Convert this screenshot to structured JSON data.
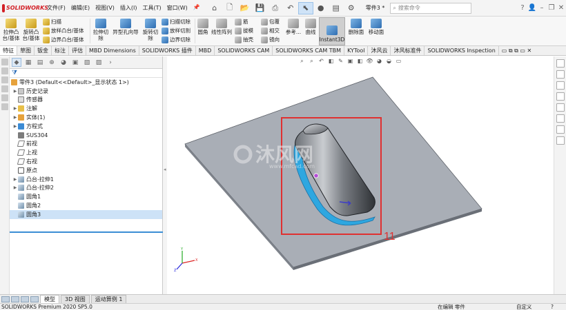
{
  "titlebar": {
    "logo_text": "SOLIDWORKS",
    "menus": [
      "文件(F)",
      "编辑(E)",
      "视图(V)",
      "插入(I)",
      "工具(T)",
      "窗口(W)"
    ],
    "doc_name": "零件3 *",
    "search_placeholder": "搜索命令"
  },
  "ribbon": {
    "extrude_boss": "拉伸凸\n台/基体",
    "revolve_boss": "旋转凸\n台/基体",
    "sweep": "扫描",
    "loft": "放样凸台/基体",
    "boundary_boss": "边界凸台/基体",
    "extrude_cut": "拉伸切\n除",
    "hole_wizard": "异型孔向导",
    "revolve_cut": "旋转切\n除",
    "swept_cut": "扫描切除",
    "lofted_cut": "放样切割",
    "boundary_cut": "边界切除",
    "fillet": "圆角",
    "linear_pattern": "线性阵列",
    "rib": "筋",
    "draft": "拔模",
    "shell": "抽壳",
    "wrap": "包覆",
    "intersect": "相交",
    "mirror": "镜向",
    "reference": "参考...",
    "curves": "曲线",
    "instant3d": "Instant3D",
    "delete_face": "删除面",
    "move_face": "移动面"
  },
  "tabs": [
    "特征",
    "草图",
    "钣金",
    "标注",
    "评估",
    "MBD Dimensions",
    "SOLIDWORKS 插件",
    "MBD",
    "SOLIDWORKS CAM",
    "SOLIDWORKS CAM TBM",
    "KYTool",
    "沐风云",
    "沐风标准件",
    "SOLIDWORKS Inspection"
  ],
  "tree": {
    "root": "零件3  (Default<<Default>_显示状态 1>)",
    "items": [
      {
        "label": "历史记录",
        "icon": "history-icon",
        "expandable": true
      },
      {
        "label": "传感器",
        "icon": "sensor-icon",
        "expandable": false
      },
      {
        "label": "注解",
        "icon": "annotation-icon",
        "expandable": true
      },
      {
        "label": "实体(1)",
        "icon": "solid-body-icon",
        "expandable": true
      },
      {
        "label": "方程式",
        "icon": "equation-icon",
        "expandable": true
      },
      {
        "label": "SUS304",
        "icon": "material-icon",
        "expandable": false
      },
      {
        "label": "前视",
        "icon": "plane-icon",
        "expandable": false
      },
      {
        "label": "上视",
        "icon": "plane-icon",
        "expandable": false
      },
      {
        "label": "右视",
        "icon": "plane-icon",
        "expandable": false
      },
      {
        "label": "原点",
        "icon": "origin-icon",
        "expandable": false
      },
      {
        "label": "凸台-拉伸1",
        "icon": "extrude-icon",
        "expandable": true
      },
      {
        "label": "凸台-拉伸2",
        "icon": "extrude-icon",
        "expandable": true
      },
      {
        "label": "圆角1",
        "icon": "fillet-icon",
        "expandable": false
      },
      {
        "label": "圆角2",
        "icon": "fillet-icon",
        "expandable": false
      },
      {
        "label": "圆角3",
        "icon": "fillet-icon",
        "expandable": false,
        "selected": true
      }
    ]
  },
  "viewport": {
    "annotation_number": "11",
    "watermark_cn": "沐风网",
    "watermark_url": "www.mfcad.com",
    "highlight_color": "#e03030",
    "plate_color": "#a9aeb6"
  },
  "bottom_tabs": [
    "模型",
    "3D 视图",
    "运动算例 1"
  ],
  "status": {
    "left": "SOLIDWORKS Premium 2020 SP5.0",
    "editing": "在编辑 零件",
    "units": "自定义"
  }
}
